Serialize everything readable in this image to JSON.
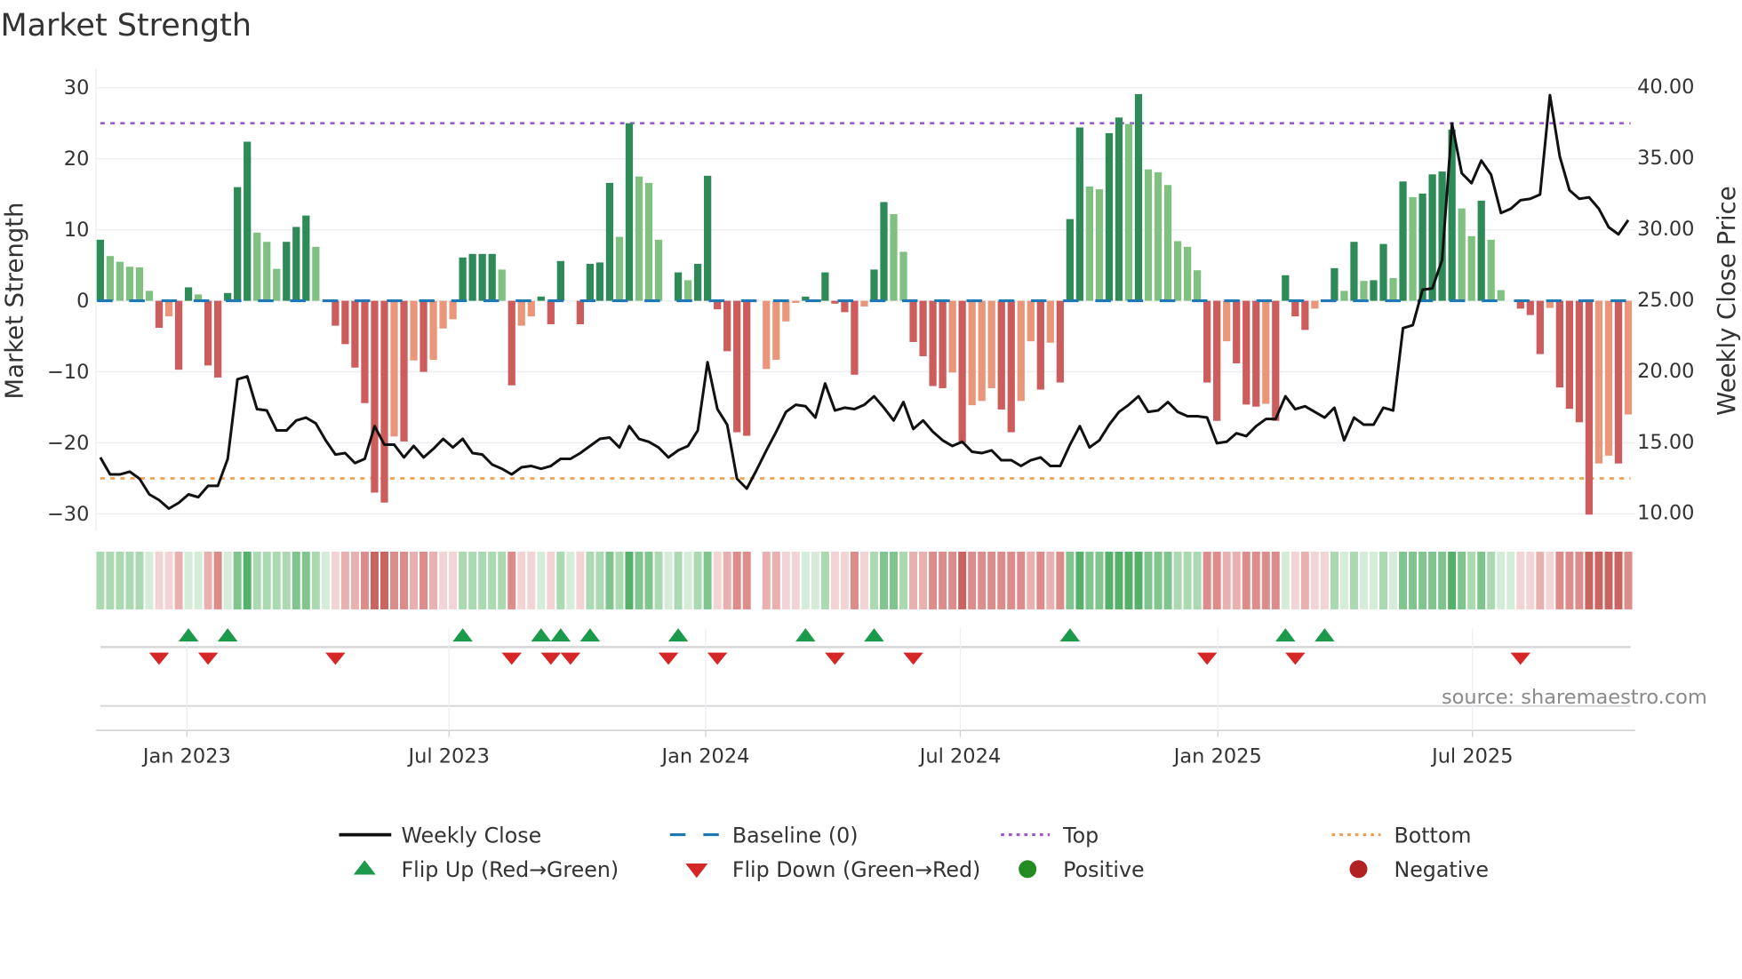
{
  "title": "Market Strength",
  "source_text": "source: sharemaestro.com",
  "legend": {
    "weekly_close": "Weekly Close",
    "baseline": "Baseline (0)",
    "top": "Top",
    "bottom": "Bottom",
    "flip_up": "Flip Up (Red→Green)",
    "flip_down": "Flip Down (Green→Red)",
    "positive": "Positive",
    "negative": "Negative"
  },
  "colors": {
    "strong_positive": "#2e8b57",
    "weak_positive": "#80c080",
    "strong_negative": "#cd5c5c",
    "weak_negative": "#e9967a",
    "baseline": "#1f77b4",
    "top": "#9b59d0",
    "bottom": "#f0a050",
    "close": "#111111",
    "flip_up": "#1a9a4a",
    "flip_down": "#d62728",
    "positive_dot": "#228b22",
    "negative_dot": "#b22222"
  },
  "chart_data": {
    "type": "bar",
    "title": "Market Strength",
    "ylabel": "Market Strength",
    "y2label": "Weekly Close Price",
    "ylim": [
      -32,
      32
    ],
    "y2lim": [
      9.4,
      40.6
    ],
    "yticks": [
      "30",
      "20",
      "10",
      "0",
      "−10",
      "−20",
      "−30"
    ],
    "ytick_values": [
      30,
      20,
      10,
      0,
      -10,
      -20,
      -30
    ],
    "y2ticks": [
      "40.00",
      "35.00",
      "30.00",
      "25.00",
      "20.00",
      "15.00",
      "10.00"
    ],
    "y2tick_values": [
      40,
      35,
      30,
      25,
      20,
      15,
      10
    ],
    "top_level": 25,
    "bottom_level": -25,
    "xticks": [
      {
        "label": "Jan 2023",
        "week": 8.84
      },
      {
        "label": "Jul 2023",
        "week": 35.6
      },
      {
        "label": "Jan 2024",
        "week": 61.8
      },
      {
        "label": "Jul 2024",
        "week": 87.8
      },
      {
        "label": "Jan 2025",
        "week": 114.1
      },
      {
        "label": "Jul 2025",
        "week": 140.1
      }
    ],
    "strength": [
      8.6,
      6.3,
      5.5,
      4.8,
      4.7,
      1.4,
      -3.8,
      -2.2,
      -9.7,
      1.9,
      0.9,
      -9.1,
      -10.8,
      1.1,
      16.0,
      22.4,
      9.6,
      8.3,
      4.5,
      8.3,
      10.4,
      12.0,
      7.6,
      0,
      -3.5,
      -6.1,
      -9.4,
      -14.4,
      -27.0,
      -28.4,
      -19.1,
      -19.8,
      -8.4,
      -10.0,
      -8.3,
      -3.9,
      -2.6,
      6.1,
      6.6,
      6.6,
      6.6,
      4.4,
      -11.9,
      -3.5,
      -2.2,
      0.6,
      -3.3,
      5.6,
      0,
      -3.3,
      5.2,
      5.4,
      16.6,
      9.0,
      25.0,
      17.5,
      16.6,
      8.6,
      0,
      4.0,
      2.9,
      5.2,
      17.6,
      -1.2,
      -7.1,
      -18.5,
      -19.0,
      0,
      -9.6,
      -8.3,
      -2.9,
      -0.3,
      0.6,
      0,
      4.0,
      -0.4,
      -1.6,
      -10.4,
      -0.8,
      4.4,
      13.9,
      12.2,
      6.9,
      -5.8,
      -7.8,
      -12.0,
      -12.3,
      -10.1,
      -20.0,
      -14.7,
      -14.1,
      -12.3,
      -15.3,
      -18.5,
      -14.1,
      -5.7,
      -12.5,
      -5.9,
      -11.5,
      11.5,
      24.4,
      16.1,
      15.7,
      23.6,
      25.8,
      24.9,
      29.1,
      18.5,
      18.1,
      16.3,
      8.4,
      7.6,
      4.3,
      -11.5,
      -16.9,
      -5.7,
      -8.8,
      -14.6,
      -14.9,
      -14.5,
      -16.9,
      3.6,
      -2.2,
      -4.1,
      -1.1,
      0,
      4.6,
      1.4,
      8.3,
      2.8,
      2.9,
      8.0,
      3.2,
      16.8,
      14.6,
      15.1,
      17.8,
      18.2,
      24.1,
      13.0,
      9.1,
      14.1,
      8.6,
      1.5,
      0,
      -1.1,
      -2.0,
      -7.5,
      -1.0,
      -12.2,
      -15.2,
      -17.1,
      -30.1,
      -22.9,
      -21.8,
      -22.9,
      -16.0
    ],
    "strong": [
      1,
      0,
      0,
      0,
      0,
      0,
      1,
      0,
      1,
      1,
      0,
      1,
      1,
      1,
      1,
      1,
      0,
      0,
      0,
      1,
      1,
      1,
      0,
      0,
      1,
      1,
      1,
      1,
      1,
      1,
      0,
      1,
      0,
      1,
      0,
      0,
      0,
      1,
      1,
      1,
      1,
      0,
      1,
      0,
      0,
      1,
      1,
      1,
      0,
      1,
      1,
      1,
      1,
      0,
      1,
      0,
      0,
      0,
      0,
      1,
      0,
      1,
      1,
      1,
      1,
      1,
      1,
      0,
      0,
      0,
      0,
      0,
      1,
      0,
      1,
      1,
      1,
      1,
      0,
      1,
      1,
      0,
      0,
      1,
      1,
      1,
      1,
      0,
      1,
      0,
      0,
      0,
      1,
      1,
      0,
      0,
      1,
      0,
      1,
      1,
      1,
      0,
      0,
      1,
      1,
      0,
      1,
      0,
      0,
      0,
      0,
      0,
      0,
      1,
      1,
      0,
      1,
      1,
      1,
      0,
      1,
      1,
      1,
      1,
      0,
      0,
      1,
      0,
      1,
      0,
      1,
      1,
      0,
      1,
      0,
      1,
      1,
      1,
      1,
      0,
      0,
      1,
      0,
      0,
      0,
      1,
      1,
      1,
      0,
      1,
      1,
      1,
      1,
      0,
      0,
      1,
      0
    ],
    "weekly_close": [
      13.9,
      12.7,
      12.7,
      12.9,
      12.4,
      11.3,
      10.9,
      10.3,
      10.7,
      11.3,
      11.1,
      11.9,
      11.9,
      13.8,
      19.4,
      19.6,
      17.3,
      17.2,
      15.8,
      15.8,
      16.5,
      16.7,
      16.3,
      15.1,
      14.1,
      14.2,
      13.5,
      13.8,
      16.1,
      14.8,
      14.8,
      13.9,
      14.7,
      13.9,
      14.5,
      15.2,
      14.6,
      15.2,
      14.2,
      14.1,
      13.4,
      13.1,
      12.7,
      13.2,
      13.3,
      13.1,
      13.3,
      13.8,
      13.8,
      14.2,
      14.7,
      15.2,
      15.3,
      14.6,
      16.1,
      15.2,
      15.0,
      14.6,
      13.9,
      14.4,
      14.7,
      15.8,
      20.6,
      17.3,
      16.2,
      12.4,
      11.7,
      13.0,
      14.4,
      15.7,
      17.1,
      17.6,
      17.5,
      16.7,
      19.1,
      17.2,
      17.4,
      17.3,
      17.6,
      18.2,
      17.4,
      16.5,
      17.8,
      15.9,
      16.5,
      15.7,
      15.1,
      14.7,
      15.0,
      14.3,
      14.2,
      14.4,
      13.7,
      13.7,
      13.3,
      13.7,
      13.9,
      13.3,
      13.3,
      14.8,
      16.1,
      14.6,
      15.1,
      16.2,
      17.1,
      17.6,
      18.2,
      17.1,
      17.2,
      17.8,
      17.1,
      16.8,
      16.8,
      16.7,
      14.9,
      15.0,
      15.6,
      15.4,
      16.1,
      16.6,
      16.6,
      18.2,
      17.3,
      17.5,
      17.1,
      16.7,
      17.4,
      15.1,
      16.7,
      16.2,
      16.2,
      17.4,
      17.2,
      23.0,
      23.2,
      25.7,
      25.8,
      27.8,
      37.4,
      33.9,
      33.2,
      34.8,
      33.8,
      31.1,
      31.4,
      32.0,
      32.1,
      32.4,
      39.4,
      35.1,
      32.7,
      32.1,
      32.2,
      31.4,
      30.1,
      29.6,
      30.6
    ],
    "heat_gap_weeks": [
      67
    ],
    "flip_up_weeks": [
      9,
      13,
      37,
      45,
      47,
      50,
      59,
      72,
      79,
      99,
      121,
      125
    ],
    "flip_down_weeks": [
      6,
      11,
      24,
      42,
      46,
      48,
      58,
      63,
      75,
      83,
      113,
      122,
      145
    ],
    "legend_position": "bottom"
  }
}
